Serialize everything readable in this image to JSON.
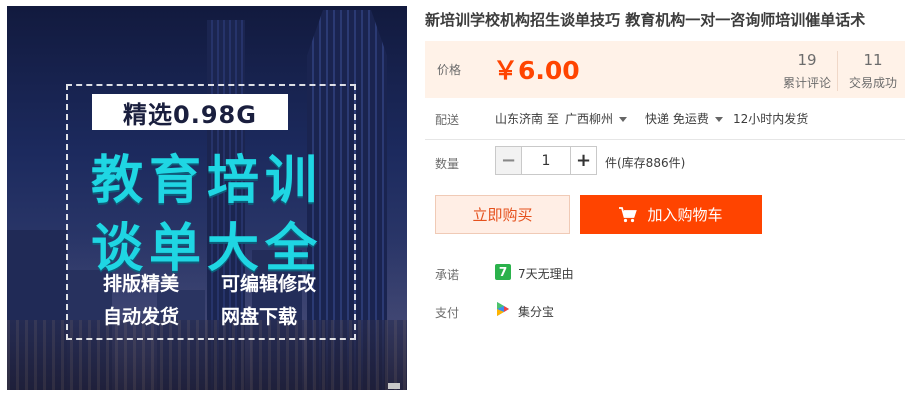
{
  "product_image": {
    "badge": "精选0.98G",
    "headline_line1": "教育培训",
    "headline_line2": "谈单大全",
    "features": [
      "排版精美",
      "可编辑修改",
      "自动发货",
      "网盘下载"
    ]
  },
  "title": "新培训学校机构招生谈单技巧 教育机构一对一咨询师培训催单话术",
  "price": {
    "label": "价格",
    "value": "￥6.00",
    "reviews_count": "19",
    "reviews_label": "累计评论",
    "deals_count": "11",
    "deals_label": "交易成功"
  },
  "shipping": {
    "label": "配送",
    "from": "山东济南 至",
    "to": "广西柳州",
    "method": "快递 免运费",
    "dispatch": "12小时内发货"
  },
  "quantity": {
    "label": "数量",
    "minus": "−",
    "value": "1",
    "plus": "+",
    "stock": "件(库存886件)"
  },
  "actions": {
    "buy_now": "立即购买",
    "add_to_cart": "加入购物车"
  },
  "promise": {
    "label": "承诺",
    "icon_text": "7",
    "text": "7天无理由"
  },
  "payment": {
    "label": "支付",
    "text": "集分宝"
  },
  "colors": {
    "accent": "#ff4400",
    "price_bg": "#fff2e8",
    "headline": "#1fd6e3"
  },
  "icons": {
    "cart": "cart-icon",
    "promise": "seven-day-icon",
    "payment": "jifenbao-icon",
    "dropdown": "caret-down-icon"
  }
}
